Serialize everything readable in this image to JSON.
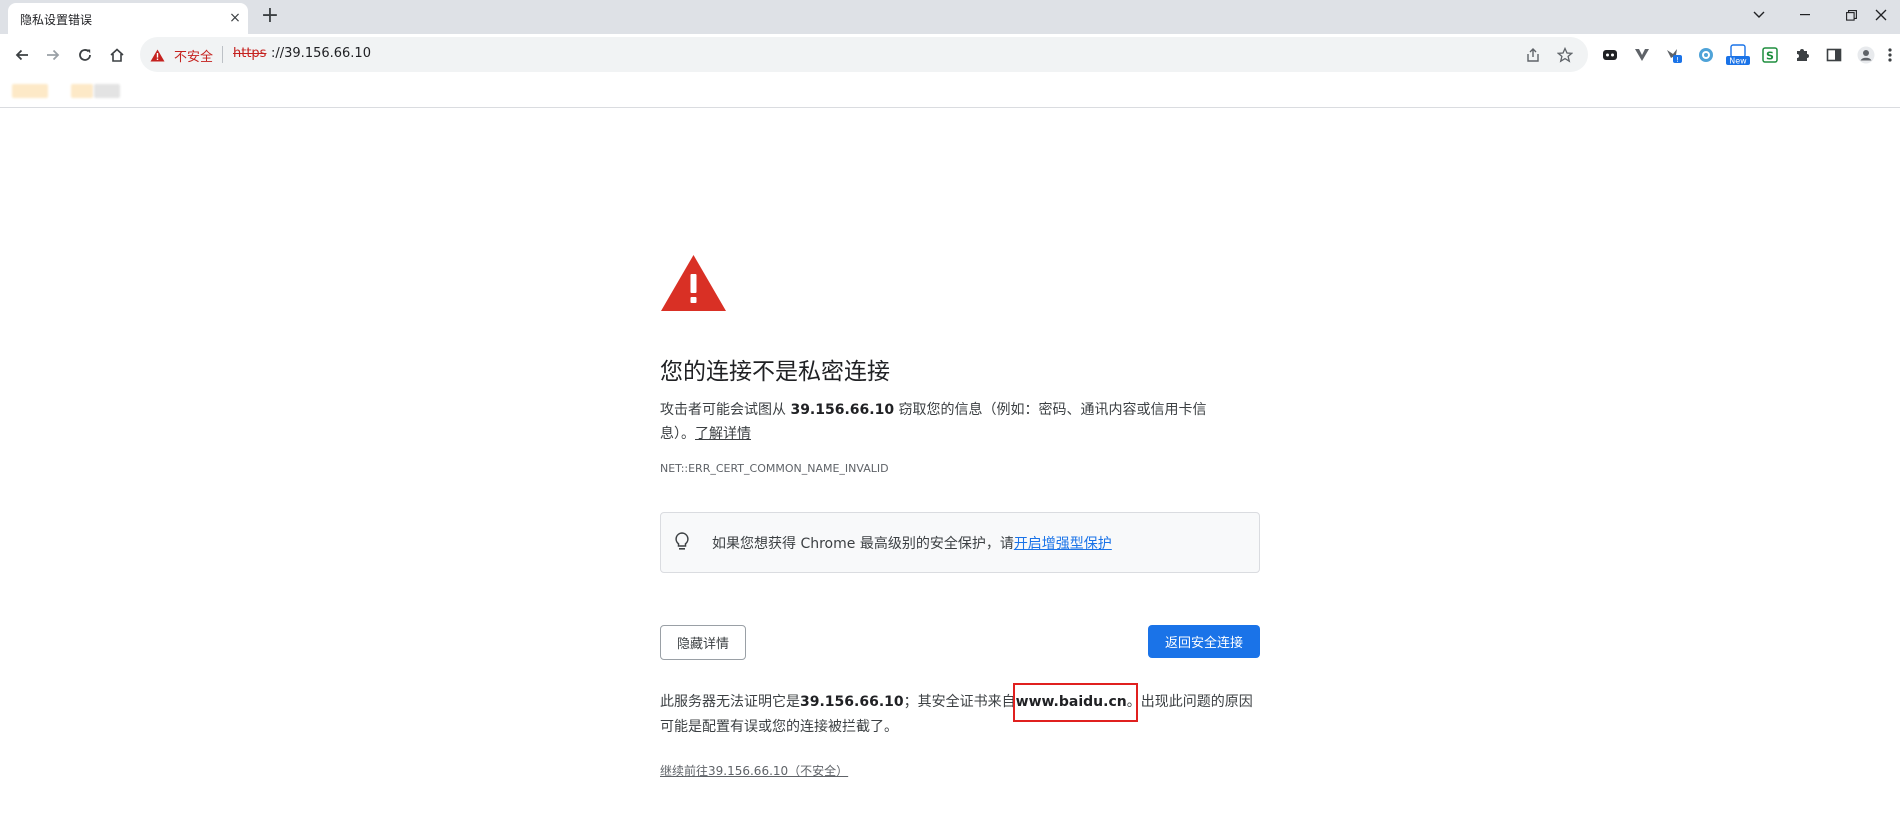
{
  "tab": {
    "title": "隐私设置错误",
    "close": "×",
    "new_tab": "+"
  },
  "window_controls": [
    "tab-search",
    "minimize",
    "restore",
    "close"
  ],
  "toolbar": {
    "security_label": "不安全",
    "url_scheme": "https",
    "url_rest": "://39.156.66.10",
    "extensions": [
      "ext-1",
      "ext-vuetify",
      "ext-3",
      "ext-4",
      "ext-new",
      "ext-s",
      "extensions-puzzle",
      "side-panel",
      "profile",
      "menu"
    ],
    "new_badge": "New",
    "s_badge": "S"
  },
  "colors": {
    "accent": "#1a73e8",
    "danger": "#d93025",
    "highlight_box": "#e0201f"
  },
  "interstitial": {
    "heading": "您的连接不是私密连接",
    "para_before": "攻击者可能会试图从 ",
    "host": "39.156.66.10",
    "para_after": " 窃取您的信息（例如：密码、通讯内容或信用卡信息）。",
    "learn_more": "了解详情",
    "error_code": "NET::ERR_CERT_COMMON_NAME_INVALID",
    "enhanced_text": "如果您想获得 Chrome 最高级别的安全保护，请",
    "enhanced_link": "开启增强型保护",
    "hide_details": "隐藏详情",
    "back_to_safety": "返回安全连接",
    "details_1": "此服务器无法证明它是",
    "details_host": "39.156.66.10",
    "details_2": "；其安全证书来自",
    "cert_domain": "www.baidu.cn",
    "details_3": "。出现此问题的原因可能是配置有误或您的连接被拦截了。",
    "proceed": "继续前往39.156.66.10（不安全）"
  }
}
